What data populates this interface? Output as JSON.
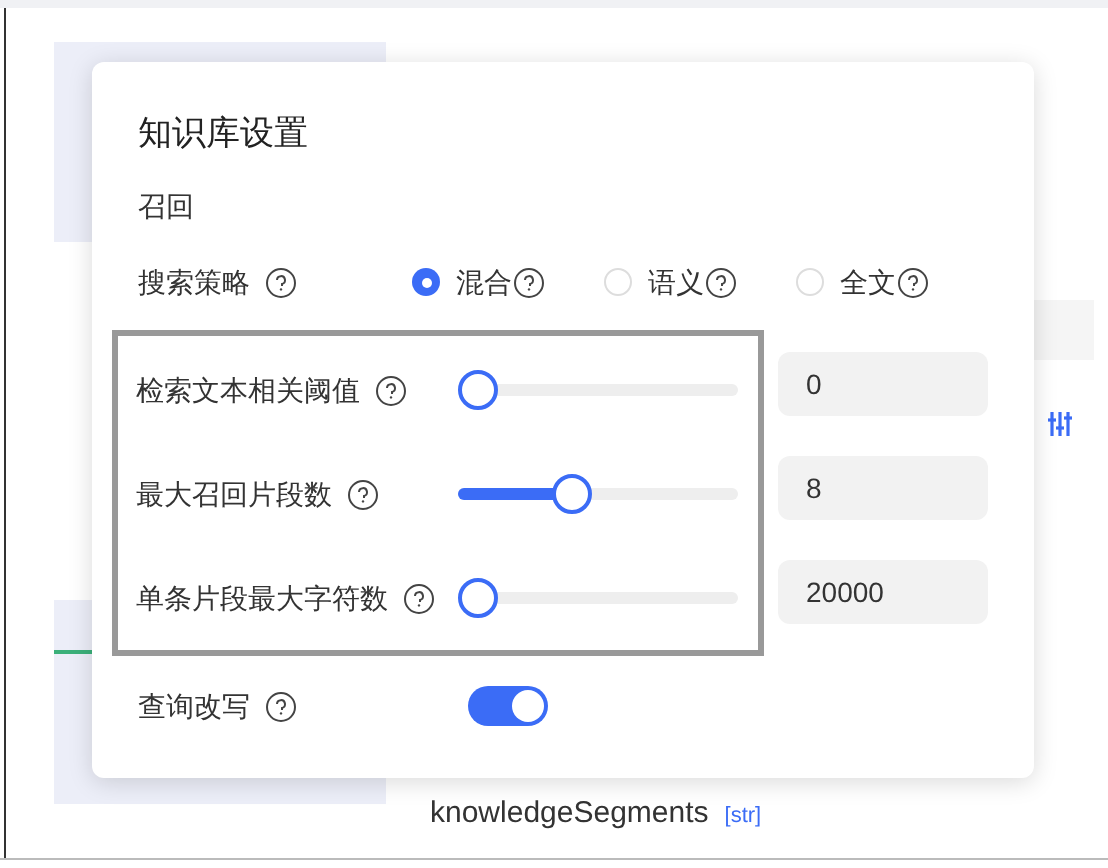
{
  "background": {
    "field_name": "knowledgeSegments",
    "field_type": "[str]"
  },
  "dialog": {
    "title": "知识库设置",
    "section": "召回",
    "search_strategy": {
      "label": "搜索策略",
      "options": [
        {
          "label": "混合",
          "selected": true
        },
        {
          "label": "语义",
          "selected": false
        },
        {
          "label": "全文",
          "selected": false
        }
      ]
    },
    "sliders": [
      {
        "label": "检索文本相关阈值",
        "level": 0,
        "value": "0"
      },
      {
        "label": "最大召回片段数",
        "level": 0.39,
        "value": "8"
      },
      {
        "label": "单条片段最大字符数",
        "level": 0,
        "value": "20000"
      }
    ],
    "query_rewrite": {
      "label": "查询改写",
      "on": true
    }
  }
}
